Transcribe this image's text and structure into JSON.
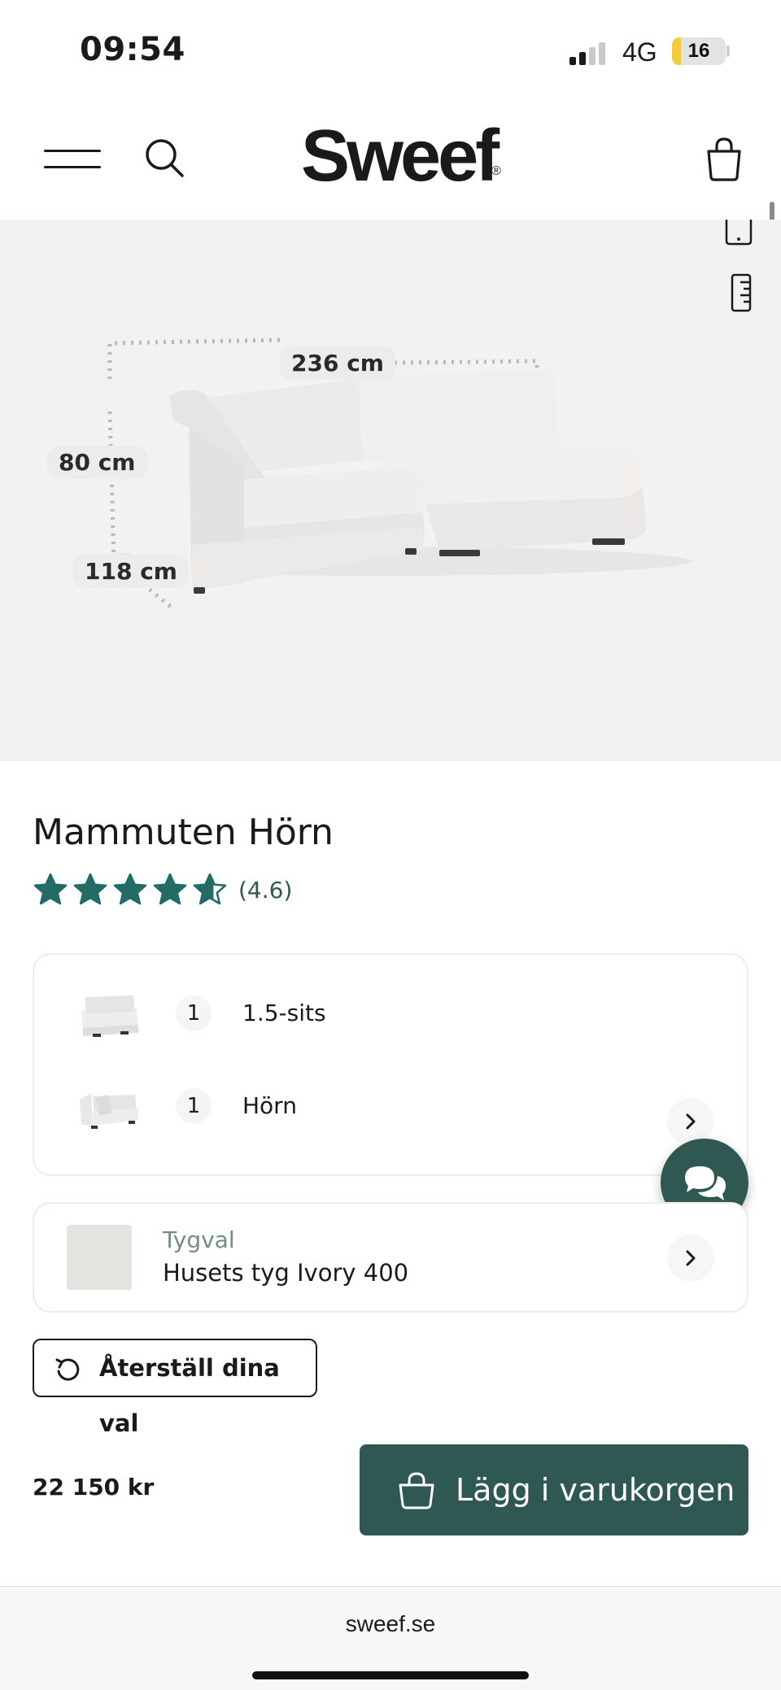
{
  "status_bar": {
    "time": "09:54",
    "network": "4G",
    "battery": "16",
    "battery_level": 0.16
  },
  "header": {
    "brand": "Sweef",
    "brand_mark": "®"
  },
  "hero": {
    "dimensions": {
      "width": "236 cm",
      "height": "80 cm",
      "depth": "118 cm"
    }
  },
  "product": {
    "title": "Mammuten Hörn",
    "rating_value": 4.6,
    "rating_text": "(4.6)",
    "star_color": "#226b66"
  },
  "configuration": {
    "modules": [
      {
        "qty": "1",
        "label": "1.5-sits"
      },
      {
        "qty": "1",
        "label": "Hörn"
      }
    ]
  },
  "fabric": {
    "caption": "Tygval",
    "name": "Husets tyg Ivory 400"
  },
  "actions": {
    "reset_label": "Återställ dina val",
    "price": "22 150 kr",
    "add_to_cart_label": "Lägg i varukorgen"
  },
  "browser": {
    "url": "sweef.se"
  },
  "colors": {
    "accent": "#2f5853",
    "hero_background": "#f2f2f2"
  }
}
